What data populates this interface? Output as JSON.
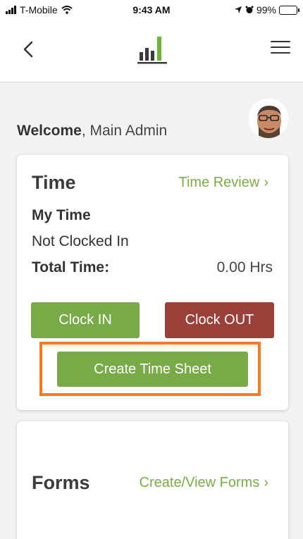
{
  "status_bar": {
    "carrier": "T-Mobile",
    "time": "9:43 AM",
    "battery": "99%"
  },
  "nav": {
    "back_icon": "chevron-left-icon",
    "logo_icon": "bar-chart-logo-icon",
    "menu_icon": "hamburger-menu-icon"
  },
  "welcome": {
    "greeting": "Welcome",
    "name": ", Main Admin"
  },
  "time_card": {
    "title": "Time",
    "link": "Time Review",
    "my_time_label": "My Time",
    "status": "Not Clocked In",
    "total_label": "Total Time:",
    "total_value": "0.00 Hrs",
    "clock_in": "Clock IN",
    "clock_out": "Clock OUT",
    "create_sheet": "Create Time Sheet"
  },
  "forms_card": {
    "title": "Forms",
    "link": "Create/View Forms"
  },
  "colors": {
    "accent_green": "#78aa47",
    "clock_out_red": "#9a4039",
    "highlight_orange": "#f47b20"
  }
}
